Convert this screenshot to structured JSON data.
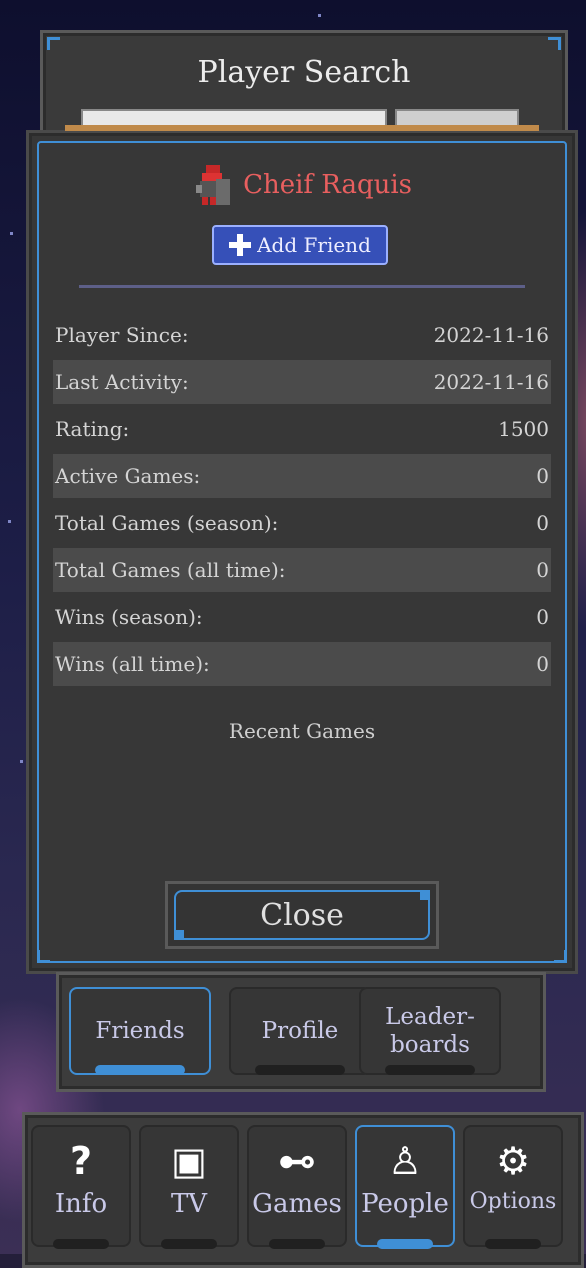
{
  "search_panel": {
    "title": "Player Search"
  },
  "profile": {
    "player_name": "Cheif Raquis",
    "add_friend_label": "Add Friend",
    "stats": [
      {
        "label": "Player Since:",
        "value": "2022-11-16"
      },
      {
        "label": "Last Activity:",
        "value": "2022-11-16"
      },
      {
        "label": "Rating:",
        "value": "1500"
      },
      {
        "label": "Active Games:",
        "value": "0"
      },
      {
        "label": "Total Games (season):",
        "value": "0"
      },
      {
        "label": "Total Games (all time):",
        "value": "0"
      },
      {
        "label": "Wins (season):",
        "value": "0"
      },
      {
        "label": "Wins (all time):",
        "value": "0"
      }
    ],
    "recent_games_label": "Recent Games",
    "close_label": "Close"
  },
  "social_tabs": [
    {
      "label": "Friends",
      "active": true
    },
    {
      "label": "Profile",
      "active": false
    },
    {
      "label": "Leader-\nboards",
      "active": false
    }
  ],
  "nav_tabs": [
    {
      "label": "Info",
      "icon": "question-icon",
      "glyph": "?",
      "active": false
    },
    {
      "label": "TV",
      "icon": "film-icon",
      "glyph": "▣",
      "active": false
    },
    {
      "label": "Games",
      "icon": "gamepad-icon",
      "glyph": "⊷",
      "active": false
    },
    {
      "label": "People",
      "icon": "person-icon",
      "glyph": "♙",
      "active": true
    },
    {
      "label": "Options",
      "icon": "gear-icon",
      "glyph": "⚙",
      "active": false
    }
  ],
  "colors": {
    "accent": "#3f8fd6",
    "player_name": "#e85f5f",
    "button": "#3650b8"
  }
}
